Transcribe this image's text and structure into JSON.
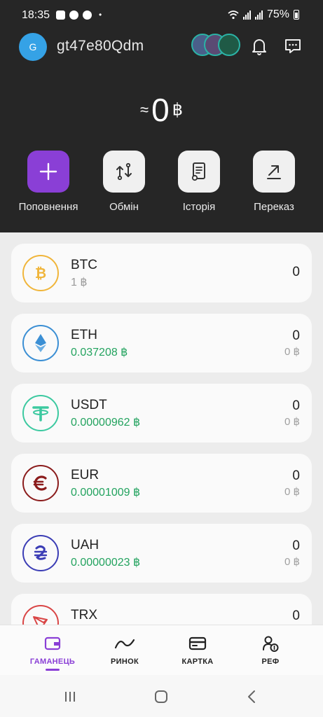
{
  "status_bar": {
    "time": "18:35",
    "battery": "75%"
  },
  "header": {
    "avatar_letter": "G",
    "username": "gt47e80Qdm"
  },
  "balance": {
    "approx": "≈",
    "amount": "0",
    "currency": "฿"
  },
  "actions": [
    {
      "label": "Поповнення"
    },
    {
      "label": "Обмін"
    },
    {
      "label": "Історія"
    },
    {
      "label": "Переказ"
    }
  ],
  "assets": [
    {
      "symbol": "BTC",
      "sub": "1 ฿",
      "balance": "0",
      "balance_sub": "",
      "color": "#f0b53a"
    },
    {
      "symbol": "ETH",
      "sub": "0.037208 ฿",
      "balance": "0",
      "balance_sub": "0 ฿",
      "color": "#3b8fd4"
    },
    {
      "symbol": "USDT",
      "sub": "0.00000962 ฿",
      "balance": "0",
      "balance_sub": "0 ฿",
      "color": "#3cc9a0"
    },
    {
      "symbol": "EUR",
      "sub": "0.00001009 ฿",
      "balance": "0",
      "balance_sub": "0 ฿",
      "color": "#8b1c1c"
    },
    {
      "symbol": "UAH",
      "sub": "0.00000023 ฿",
      "balance": "0",
      "balance_sub": "0 ฿",
      "color": "#3b3db5"
    },
    {
      "symbol": "TRX",
      "sub": "",
      "balance": "0",
      "balance_sub": "",
      "color": "#d94545"
    }
  ],
  "bottom_nav": [
    {
      "label": "ГАМАНЕЦЬ",
      "icon": "wallet-icon",
      "active": true
    },
    {
      "label": "РИНОК",
      "icon": "market-line-icon",
      "active": false
    },
    {
      "label": "КАРТКА",
      "icon": "card-icon",
      "active": false
    },
    {
      "label": "РЕФ",
      "icon": "referral-icon",
      "active": false
    }
  ],
  "colors": {
    "accent": "#8a3fd6",
    "header_bg": "#262626",
    "positive": "#23a35f"
  }
}
